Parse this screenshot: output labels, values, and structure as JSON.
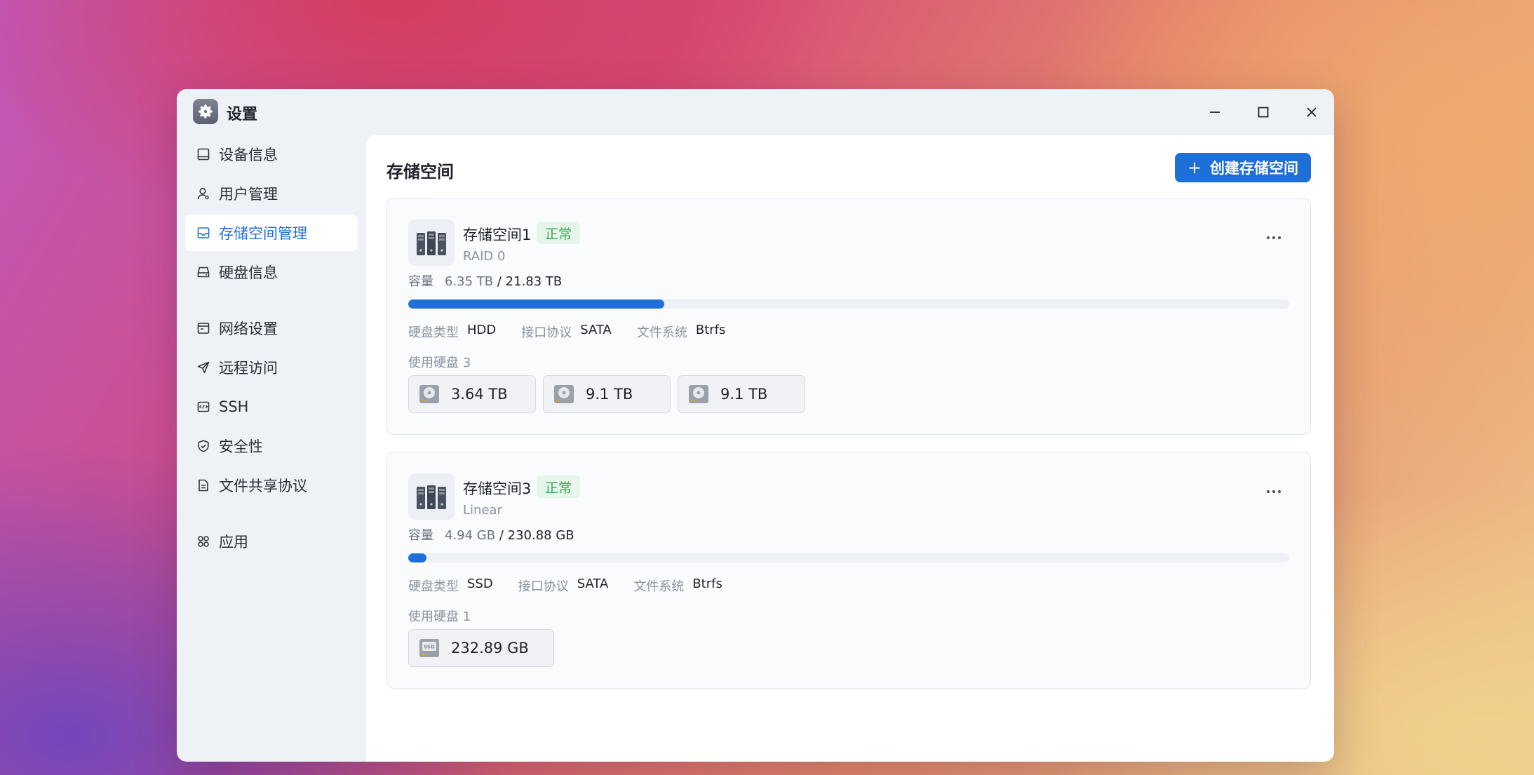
{
  "window": {
    "title": "设置",
    "icon": "gear-icon"
  },
  "sidebar": {
    "items": [
      {
        "label": "设备信息",
        "icon": "device-info-icon",
        "active": false
      },
      {
        "label": "用户管理",
        "icon": "user-icon",
        "active": false
      },
      {
        "label": "存储空间管理",
        "icon": "storage-icon",
        "active": true
      },
      {
        "label": "硬盘信息",
        "icon": "harddisk-icon",
        "active": false
      },
      {
        "label": "网络设置",
        "icon": "network-icon",
        "active": false
      },
      {
        "label": "远程访问",
        "icon": "send-icon",
        "active": false
      },
      {
        "label": "SSH",
        "icon": "terminal-icon",
        "active": false
      },
      {
        "label": "安全性",
        "icon": "shield-icon",
        "active": false
      },
      {
        "label": "文件共享协议",
        "icon": "document-icon",
        "active": false
      },
      {
        "label": "应用",
        "icon": "apps-icon",
        "active": false
      }
    ]
  },
  "main": {
    "title": "存储空间",
    "create_button": {
      "plus": "+",
      "label": "创建存储空间"
    },
    "pools": [
      {
        "name": "存储空间1",
        "status": "正常",
        "raid": "RAID 0",
        "capacity_label": "容量",
        "used": "6.35 TB",
        "total": "/ 21.83 TB",
        "usage_fraction": 0.291,
        "props": [
          {
            "key": "硬盘类型",
            "value": "HDD"
          },
          {
            "key": "接口协议",
            "value": "SATA"
          },
          {
            "key": "文件系统",
            "value": "Btrfs"
          }
        ],
        "disks_label": "使用硬盘 3",
        "disks": [
          {
            "size": "3.64 TB",
            "type": "hdd"
          },
          {
            "size": "9.1 TB",
            "type": "hdd"
          },
          {
            "size": "9.1 TB",
            "type": "hdd"
          }
        ]
      },
      {
        "name": "存储空间3",
        "status": "正常",
        "raid": "Linear",
        "capacity_label": "容量",
        "used": "4.94 GB",
        "total": "/ 230.88 GB",
        "usage_fraction": 0.021,
        "props": [
          {
            "key": "硬盘类型",
            "value": "SSD"
          },
          {
            "key": "接口协议",
            "value": "SATA"
          },
          {
            "key": "文件系统",
            "value": "Btrfs"
          }
        ],
        "disks_label": "使用硬盘 1",
        "disks": [
          {
            "size": "232.89 GB",
            "type": "ssd",
            "chip_text": "SSD"
          }
        ]
      }
    ]
  },
  "colors": {
    "accent": "#1f6fd8",
    "ok_green": "#3aa655",
    "ok_bg": "#e6f6ea"
  }
}
